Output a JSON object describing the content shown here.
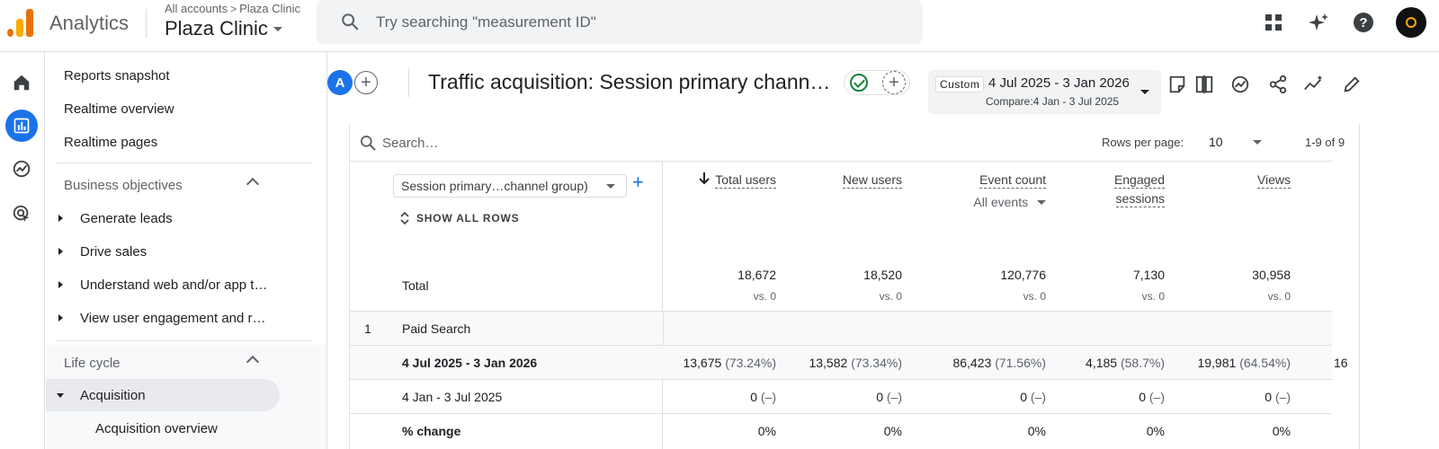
{
  "topbar": {
    "app_name": "Analytics",
    "breadcrumb_root": "All accounts",
    "breadcrumb_sep": ">",
    "breadcrumb_account": "Plaza Clinic",
    "property_name": "Plaza Clinic",
    "search_placeholder": "Try searching \"measurement ID\"",
    "icons": [
      "apps-grid-icon",
      "sparkle-icon",
      "help-icon",
      "account-avatar"
    ]
  },
  "rail": {
    "items": [
      "home-icon",
      "reports-icon",
      "explore-icon",
      "advertising-icon"
    ],
    "active": "reports-icon"
  },
  "nav": {
    "top_items": [
      "Reports snapshot",
      "Realtime overview",
      "Realtime pages"
    ],
    "business_objectives": {
      "label": "Business objectives",
      "items": [
        "Generate leads",
        "Drive sales",
        "Understand web and/or app t…",
        "View user engagement and r…"
      ]
    },
    "life_cycle": {
      "label": "Life cycle",
      "items": [
        "Acquisition"
      ],
      "subitems": [
        "Acquisition overview"
      ]
    }
  },
  "header": {
    "segment_letter": "A",
    "title": "Traffic acquisition: Session primary chann…",
    "date_chip": "Custom",
    "date_range": "4 Jul 2025 - 3 Jan 2026",
    "compare_range": "Compare:4 Jan - 3 Jul 2025",
    "tools": [
      "customize-report-icon",
      "compare-icon",
      "insights-icon",
      "share-icon",
      "trend-icon",
      "edit-icon"
    ]
  },
  "table": {
    "search_placeholder": "Search…",
    "rows_per_page_label": "Rows per page:",
    "rows_per_page": "10",
    "pager": "1-9 of 9",
    "dimension_select": "Session primary…channel group)",
    "show_all_rows": "SHOW ALL ROWS",
    "columns": [
      {
        "label": "Total users",
        "sorted": true
      },
      {
        "label": "New users"
      },
      {
        "label": "Event count",
        "sub": "All events"
      },
      {
        "label": "Engaged sessions",
        "line1": "Engaged",
        "line2": "sessions"
      },
      {
        "label": "Views"
      }
    ],
    "total": {
      "label": "Total",
      "values": [
        "18,672",
        "18,520",
        "120,776",
        "7,130",
        "30,958"
      ],
      "vs": [
        "vs. 0",
        "vs. 0",
        "vs. 0",
        "vs. 0",
        "vs. 0"
      ]
    },
    "rows": [
      {
        "index": "1",
        "label": "Paid Search"
      },
      {
        "label": "4 Jul 2025 - 3 Jan 2026",
        "values": [
          "13,675",
          "13,582",
          "86,423",
          "4,185",
          "19,981"
        ],
        "pcts": [
          "(73.24%)",
          "(73.34%)",
          "(71.56%)",
          "(58.7%)",
          "(64.54%)"
        ],
        "overflow": "16"
      },
      {
        "label": "4 Jan - 3 Jul 2025",
        "values": [
          "0",
          "0",
          "0",
          "0",
          "0"
        ],
        "pcts": [
          "(–)",
          "(–)",
          "(–)",
          "(–)",
          "(–)"
        ]
      },
      {
        "label": "% change",
        "values": [
          "0%",
          "0%",
          "0%",
          "0%",
          "0%"
        ]
      }
    ]
  }
}
